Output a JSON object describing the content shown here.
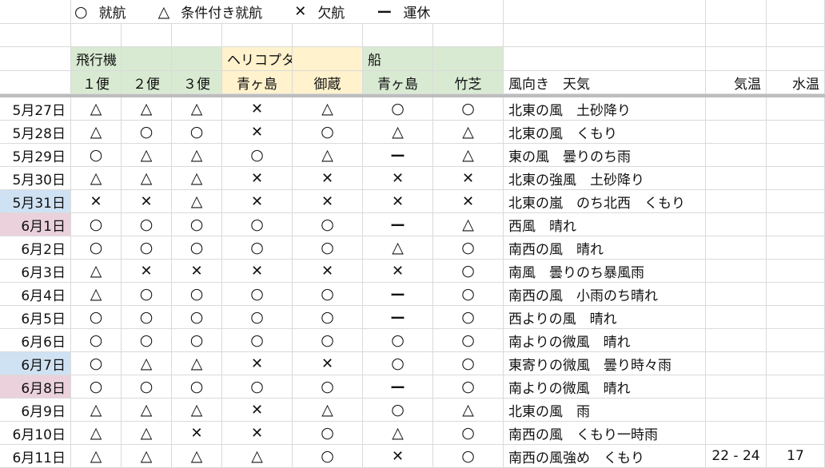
{
  "legend": [
    {
      "symbol": "○",
      "label": "就航"
    },
    {
      "symbol": "△",
      "label": "条件付き就航"
    },
    {
      "symbol": "✕",
      "label": "欠航"
    },
    {
      "symbol": "ー",
      "label": "運休"
    }
  ],
  "groups": {
    "plane": "飛行機",
    "heli": "ヘリコプター",
    "ship": "船"
  },
  "columns": [
    "１便",
    "２便",
    "３便",
    "青ヶ島",
    "御蔵",
    "青ヶ島",
    "竹芝",
    "風向き　天気",
    "気温",
    "水温"
  ],
  "rows": [
    {
      "date": "5月27日",
      "day": "",
      "marks": [
        "△",
        "△",
        "△",
        "✕",
        "△",
        "○",
        "○"
      ],
      "weather": "北東の風　土砂降り",
      "temp": "",
      "water": ""
    },
    {
      "date": "5月28日",
      "day": "",
      "marks": [
        "△",
        "○",
        "○",
        "✕",
        "○",
        "△",
        "△"
      ],
      "weather": "北東の風　くもり",
      "temp": "",
      "water": ""
    },
    {
      "date": "5月29日",
      "day": "",
      "marks": [
        "○",
        "△",
        "△",
        "○",
        "△",
        "ー",
        "△"
      ],
      "weather": "東の風　曇りのち雨",
      "temp": "",
      "water": ""
    },
    {
      "date": "5月30日",
      "day": "",
      "marks": [
        "△",
        "△",
        "△",
        "✕",
        "✕",
        "✕",
        "✕"
      ],
      "weather": "北東の強風　土砂降り",
      "temp": "",
      "water": ""
    },
    {
      "date": "5月31日",
      "day": "sat",
      "marks": [
        "✕",
        "✕",
        "△",
        "✕",
        "✕",
        "✕",
        "✕"
      ],
      "weather": "北東の嵐　のち北西　くもり",
      "temp": "",
      "water": ""
    },
    {
      "date": "6月1日",
      "day": "sun",
      "marks": [
        "○",
        "○",
        "○",
        "○",
        "○",
        "ー",
        "△"
      ],
      "weather": "西風　晴れ",
      "temp": "",
      "water": ""
    },
    {
      "date": "6月2日",
      "day": "",
      "marks": [
        "○",
        "○",
        "○",
        "○",
        "○",
        "△",
        "○"
      ],
      "weather": "南西の風　晴れ",
      "temp": "",
      "water": ""
    },
    {
      "date": "6月3日",
      "day": "",
      "marks": [
        "△",
        "✕",
        "✕",
        "✕",
        "✕",
        "✕",
        "○"
      ],
      "weather": "南風　曇りのち暴風雨",
      "temp": "",
      "water": ""
    },
    {
      "date": "6月4日",
      "day": "",
      "marks": [
        "△",
        "○",
        "○",
        "○",
        "○",
        "ー",
        "○"
      ],
      "weather": "南西の風　小雨のち晴れ",
      "temp": "",
      "water": ""
    },
    {
      "date": "6月5日",
      "day": "",
      "marks": [
        "○",
        "○",
        "○",
        "○",
        "○",
        "ー",
        "○"
      ],
      "weather": "西よりの風　晴れ",
      "temp": "",
      "water": ""
    },
    {
      "date": "6月6日",
      "day": "",
      "marks": [
        "○",
        "○",
        "○",
        "○",
        "○",
        "○",
        "○"
      ],
      "weather": "南よりの微風　晴れ",
      "temp": "",
      "water": ""
    },
    {
      "date": "6月7日",
      "day": "sat",
      "marks": [
        "○",
        "△",
        "△",
        "✕",
        "✕",
        "○",
        "○"
      ],
      "weather": "東寄りの微風　曇り時々雨",
      "temp": "",
      "water": ""
    },
    {
      "date": "6月8日",
      "day": "sun",
      "marks": [
        "○",
        "○",
        "○",
        "○",
        "○",
        "ー",
        "○"
      ],
      "weather": "南よりの微風　晴れ",
      "temp": "",
      "water": ""
    },
    {
      "date": "6月9日",
      "day": "",
      "marks": [
        "△",
        "△",
        "△",
        "✕",
        "△",
        "○",
        "△"
      ],
      "weather": "北東の風　雨",
      "temp": "",
      "water": ""
    },
    {
      "date": "6月10日",
      "day": "",
      "marks": [
        "△",
        "△",
        "✕",
        "✕",
        "○",
        "△",
        "○"
      ],
      "weather": "南西の風　くもり一時雨",
      "temp": "",
      "water": ""
    },
    {
      "date": "6月11日",
      "day": "",
      "marks": [
        "△",
        "△",
        "△",
        "△",
        "○",
        "✕",
        "○"
      ],
      "weather": "南西の風強め　くもり",
      "temp": "22 - 24",
      "water": "17"
    }
  ],
  "colors": {
    "plane_group": "#d9ead3",
    "heli_group": "#fff2cc",
    "saturday": "#cfe2f3",
    "sunday": "#ead1dc"
  }
}
